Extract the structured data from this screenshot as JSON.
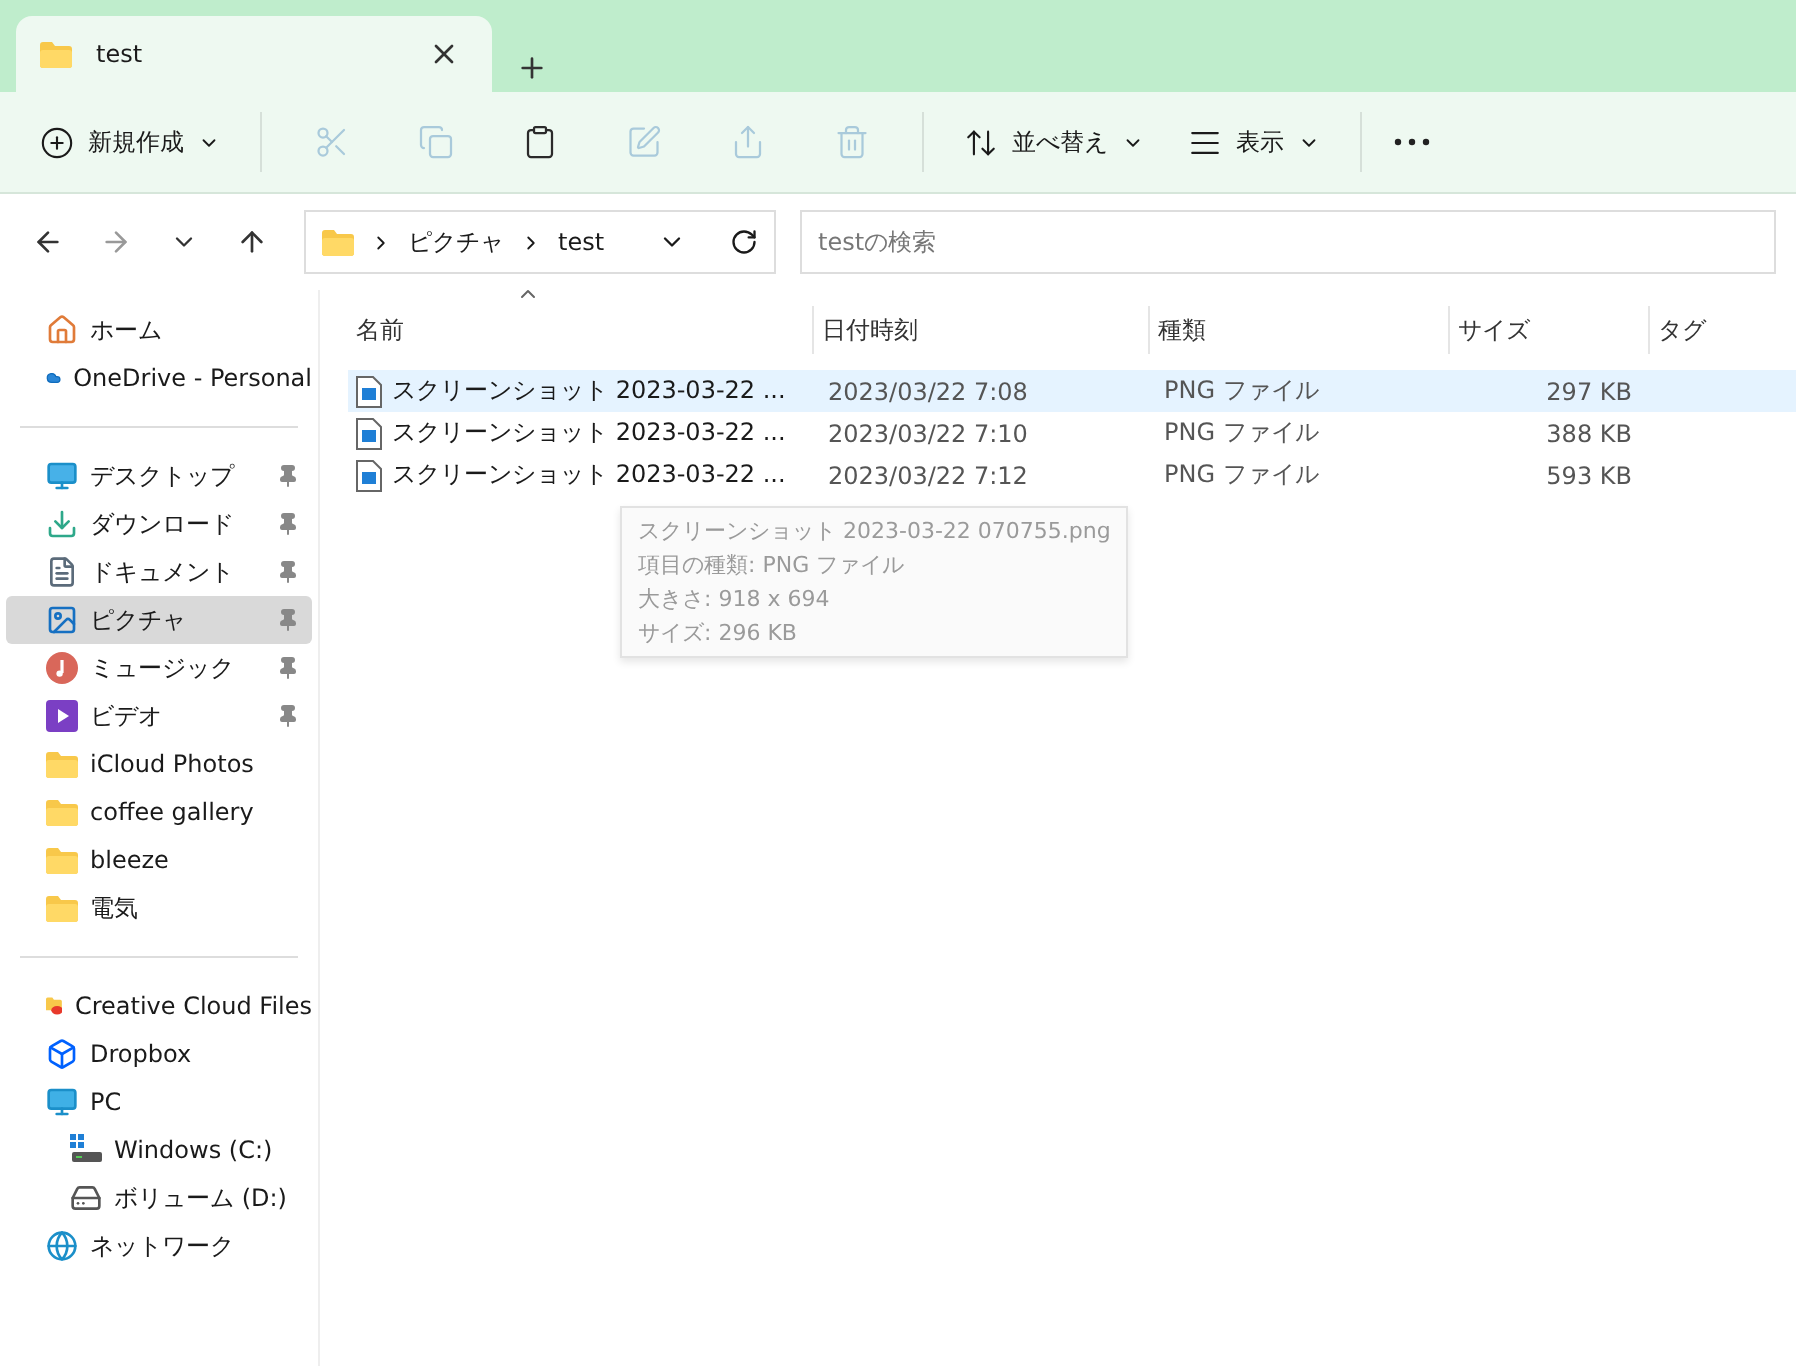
{
  "tab": {
    "title": "test",
    "selected": true
  },
  "toolbar": {
    "new_label": "新規作成",
    "actions": [
      {
        "kind": "cut",
        "disabled": true
      },
      {
        "kind": "copy",
        "disabled": true
      },
      {
        "kind": "paste",
        "disabled": false
      },
      {
        "kind": "rename",
        "disabled": true
      },
      {
        "kind": "share",
        "disabled": true
      },
      {
        "kind": "delete",
        "disabled": true
      }
    ],
    "sort_label": "並べ替え",
    "view_label": "表示"
  },
  "address": {
    "crumbs": [
      "ピクチャ",
      "test"
    ],
    "search_placeholder": "testの検索"
  },
  "sidebar": {
    "sections": [
      {
        "items": [
          {
            "kind": "home",
            "label": "ホーム",
            "pinned": false,
            "selected": false
          },
          {
            "kind": "cloud",
            "label": "OneDrive - Personal",
            "pinned": false,
            "selected": false
          }
        ]
      },
      {
        "items": [
          {
            "kind": "desktop",
            "label": "デスクトップ",
            "pinned": true,
            "selected": false
          },
          {
            "kind": "download",
            "label": "ダウンロード",
            "pinned": true,
            "selected": false
          },
          {
            "kind": "document",
            "label": "ドキュメント",
            "pinned": true,
            "selected": false
          },
          {
            "kind": "pictures",
            "label": "ピクチャ",
            "pinned": true,
            "selected": true
          },
          {
            "kind": "music",
            "label": "ミュージック",
            "pinned": true,
            "selected": false
          },
          {
            "kind": "video",
            "label": "ビデオ",
            "pinned": true,
            "selected": false
          },
          {
            "kind": "folder",
            "label": "iCloud Photos",
            "pinned": false,
            "selected": false
          },
          {
            "kind": "folder",
            "label": "coffee gallery",
            "pinned": false,
            "selected": false
          },
          {
            "kind": "folder",
            "label": "bleeze",
            "pinned": false,
            "selected": false
          },
          {
            "kind": "folder",
            "label": "電気",
            "pinned": false,
            "selected": false
          }
        ]
      },
      {
        "items": [
          {
            "kind": "creative",
            "label": "Creative Cloud Files",
            "pinned": false,
            "selected": false
          },
          {
            "kind": "dropbox",
            "label": "Dropbox",
            "pinned": false,
            "selected": false
          },
          {
            "kind": "pc",
            "label": "PC",
            "pinned": false,
            "selected": false,
            "children": [
              {
                "kind": "windrive",
                "label": "Windows (C:)",
                "pinned": false,
                "selected": false
              },
              {
                "kind": "drive",
                "label": "ボリューム (D:)",
                "pinned": false,
                "selected": false
              }
            ]
          },
          {
            "kind": "network",
            "label": "ネットワーク",
            "pinned": false,
            "selected": false
          }
        ]
      }
    ]
  },
  "table": {
    "columns": [
      "名前",
      "日付時刻",
      "種類",
      "サイズ",
      "タグ"
    ],
    "rows": [
      {
        "name": "スクリーンショット 2023-03-22 ...",
        "date": "2023/03/22 7:08",
        "type": "PNG ファイル",
        "size": "297 KB",
        "selected": true
      },
      {
        "name": "スクリーンショット 2023-03-22 ...",
        "date": "2023/03/22 7:10",
        "type": "PNG ファイル",
        "size": "388 KB",
        "selected": false
      },
      {
        "name": "スクリーンショット 2023-03-22 ...",
        "date": "2023/03/22 7:12",
        "type": "PNG ファイル",
        "size": "593 KB",
        "selected": false
      }
    ]
  },
  "tooltip": {
    "lines": [
      "スクリーンショット 2023-03-22 070755.png",
      "項目の種類: PNG ファイル",
      "大きさ: 918 x 694",
      "サイズ: 296 KB"
    ]
  }
}
